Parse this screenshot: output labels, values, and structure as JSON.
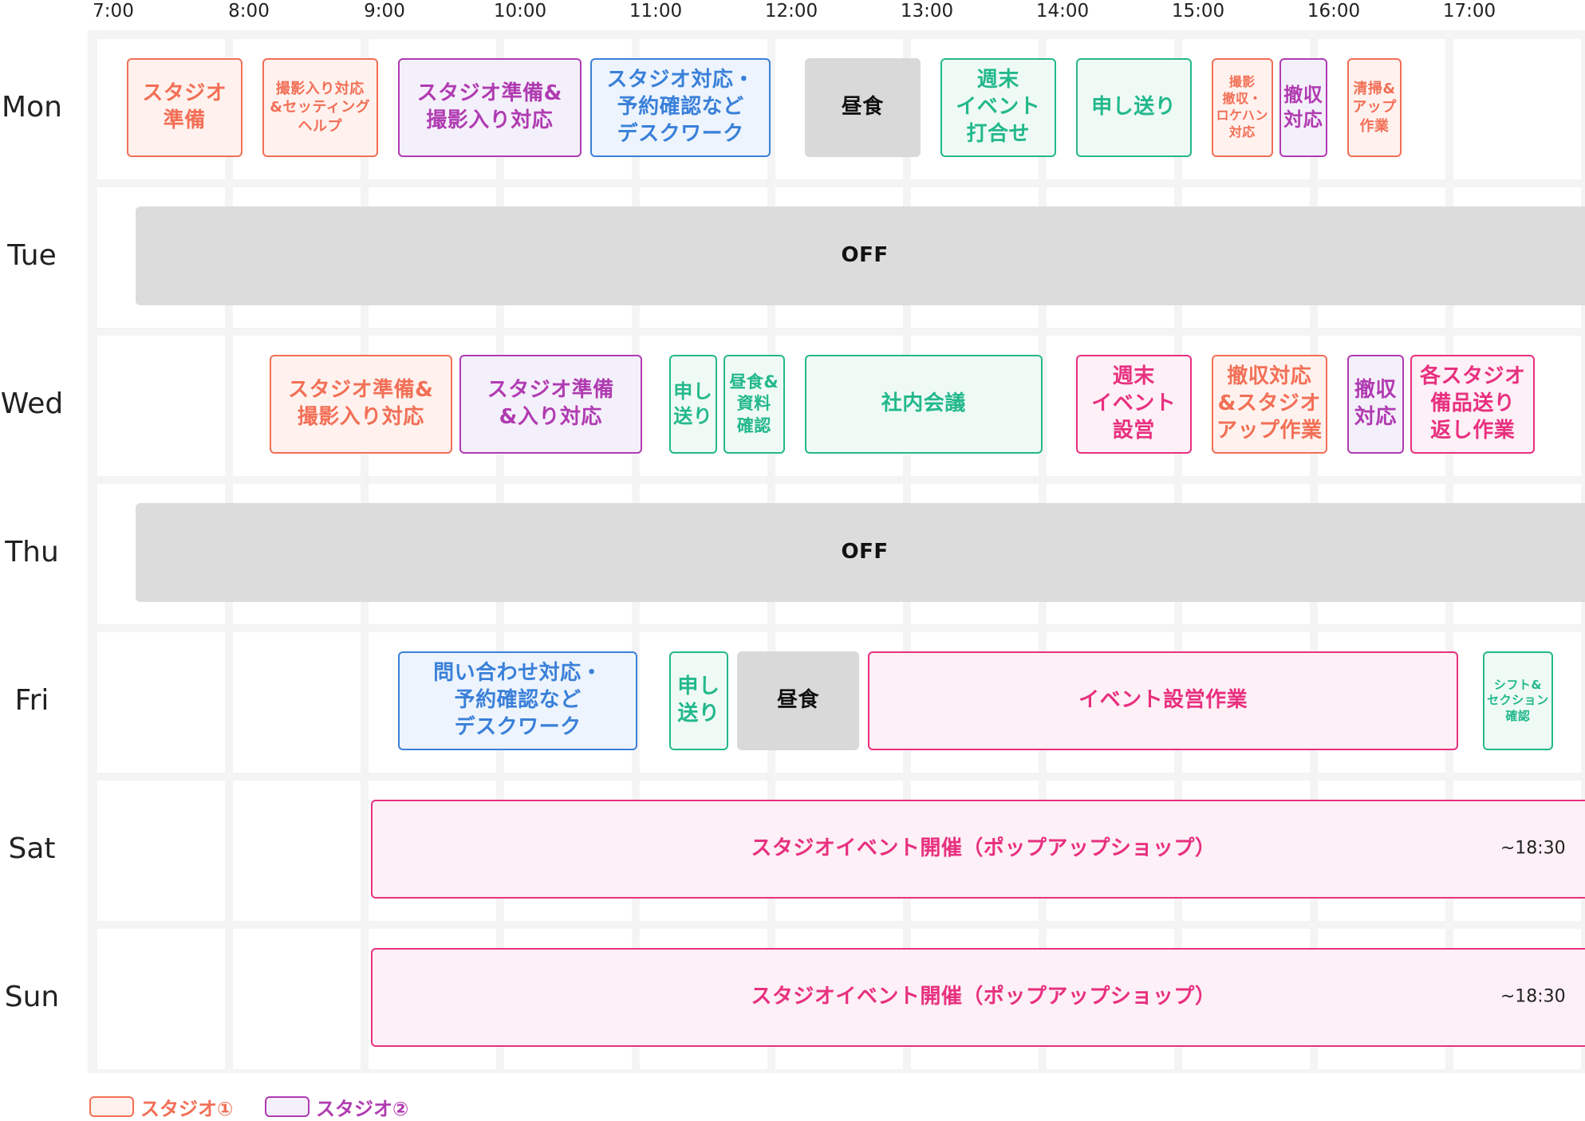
{
  "times": [
    "7:00",
    "8:00",
    "9:00",
    "10:00",
    "11:00",
    "12:00",
    "13:00",
    "14:00",
    "15:00",
    "16:00",
    "17:00"
  ],
  "days": [
    "Mon",
    "Tue",
    "Wed",
    "Thu",
    "Fri",
    "Sat",
    "Sun"
  ],
  "categories": {
    "s1": {
      "border": "#f26f56",
      "fill": "#fff2ee",
      "text": "#f26f56"
    },
    "s2": {
      "border": "#b03bb1",
      "fill": "#f4f0fb",
      "text": "#b03bb1"
    },
    "desk": {
      "border": "#3a80d9",
      "fill": "#edf4fd",
      "text": "#3a80d9"
    },
    "meet": {
      "border": "#23b88b",
      "fill": "#effaf5",
      "text": "#23b88b"
    },
    "event": {
      "border": "#e8307f",
      "fill": "#fdf0f6",
      "text": "#e8307f"
    },
    "lunch": {
      "border": "#d9d9d9",
      "fill": "#d9d9d9",
      "text": "#111111"
    },
    "off": {
      "border": "#dcdcdc",
      "fill": "#dcdcdc",
      "text": "#111111"
    }
  },
  "schedule": [
    {
      "day": "Mon",
      "items": [
        {
          "label": "スタジオ\n準備",
          "cat": "s1",
          "start": "7:06",
          "end": "7:57"
        },
        {
          "label": "撮影入り対応\n&セッティング\nヘルプ",
          "cat": "s1",
          "start": "8:06",
          "end": "8:57"
        },
        {
          "label": "スタジオ準備&\n撮影入り対応",
          "cat": "s2",
          "start": "9:06",
          "end": "10:27"
        },
        {
          "label": "スタジオ対応・\n予約確認など\nデスクワーク",
          "cat": "desk",
          "start": "10:31",
          "end": "11:51"
        },
        {
          "label": "昼食",
          "cat": "lunch",
          "start": "12:06",
          "end": "12:57"
        },
        {
          "label": "週末\nイベント\n打合せ",
          "cat": "meet",
          "start": "13:06",
          "end": "13:57"
        },
        {
          "label": "申し送り",
          "cat": "meet",
          "start": "14:06",
          "end": "14:57"
        },
        {
          "label": "撮影\n撤収・\nロケハン\n対応",
          "cat": "s1",
          "start": "15:06",
          "end": "15:33"
        },
        {
          "label": "撤収\n対応",
          "cat": "s2",
          "start": "15:36",
          "end": "15:57"
        },
        {
          "label": "清掃&\nアップ\n作業",
          "cat": "s1",
          "start": "16:06",
          "end": "16:30"
        }
      ]
    },
    {
      "day": "Tue",
      "items": [
        {
          "label": "OFF",
          "cat": "off",
          "start": "7:10",
          "end": "17:55"
        }
      ]
    },
    {
      "day": "Wed",
      "items": [
        {
          "label": "スタジオ準備&\n撮影入り対応",
          "cat": "s1",
          "start": "8:09",
          "end": "9:30"
        },
        {
          "label": "スタジオ準備\n&入り対応",
          "cat": "s2",
          "start": "9:33",
          "end": "10:54"
        },
        {
          "label": "申し\n送り",
          "cat": "meet",
          "start": "11:06",
          "end": "11:27"
        },
        {
          "label": "昼食&\n資料\n確認",
          "cat": "meet",
          "start": "11:30",
          "end": "11:57"
        },
        {
          "label": "社内会議",
          "cat": "meet",
          "start": "12:06",
          "end": "13:51"
        },
        {
          "label": "週末\nイベント\n設営",
          "cat": "event",
          "start": "14:06",
          "end": "14:57"
        },
        {
          "label": "撤収対応\n&スタジオ\nアップ作業",
          "cat": "s1",
          "start": "15:06",
          "end": "15:57"
        },
        {
          "label": "撤収\n対応",
          "cat": "s2",
          "start": "16:06",
          "end": "16:31"
        },
        {
          "label": "各スタジオ\n備品送り\n返し作業",
          "cat": "event",
          "start": "16:34",
          "end": "17:29"
        }
      ]
    },
    {
      "day": "Thu",
      "items": [
        {
          "label": "OFF",
          "cat": "off",
          "start": "7:10",
          "end": "17:55"
        }
      ]
    },
    {
      "day": "Fri",
      "items": [
        {
          "label": "問い合わせ対応・\n予約確認など\nデスクワーク",
          "cat": "desk",
          "start": "9:06",
          "end": "10:52"
        },
        {
          "label": "申し\n送り",
          "cat": "meet",
          "start": "11:06",
          "end": "11:32"
        },
        {
          "label": "昼食",
          "cat": "lunch",
          "start": "11:36",
          "end": "12:30"
        },
        {
          "label": "イベント設営作業",
          "cat": "event",
          "start": "12:34",
          "end": "16:55"
        },
        {
          "label": "シフト&\nセクション\n確認",
          "cat": "meet",
          "start": "17:06",
          "end": "17:37"
        }
      ]
    },
    {
      "day": "Sat",
      "items": [
        {
          "label": "スタジオイベント開催（ポップアップショップ）",
          "tail": "~18:30",
          "cat": "event",
          "start": "8:54",
          "end": "17:56"
        }
      ]
    },
    {
      "day": "Sun",
      "items": [
        {
          "label": "スタジオイベント開催（ポップアップショップ）",
          "tail": "~18:30",
          "cat": "event",
          "start": "8:54",
          "end": "17:56"
        }
      ]
    }
  ],
  "legend": [
    {
      "label": "スタジオ①",
      "cat": "s1"
    },
    {
      "label": "スタジオ②",
      "cat": "s2"
    }
  ]
}
